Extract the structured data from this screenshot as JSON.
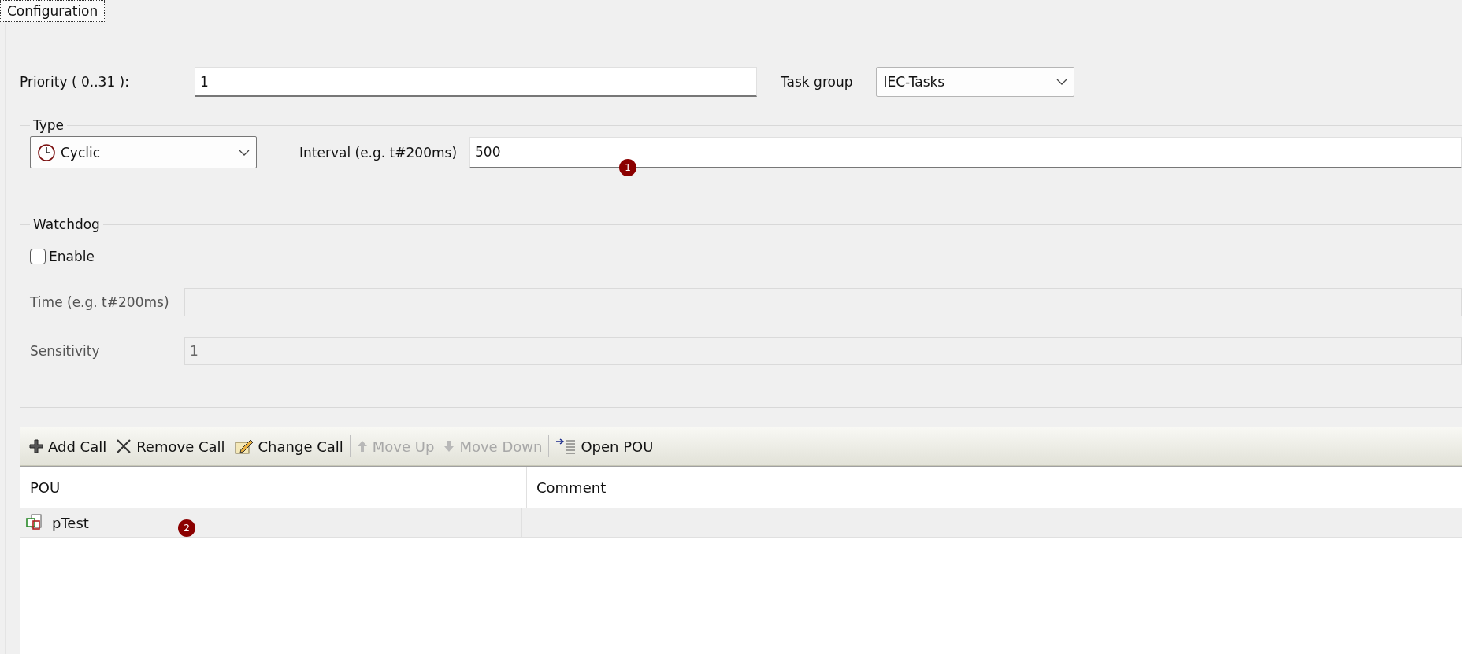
{
  "tabs": [
    {
      "label": "Configuration",
      "selected": true
    }
  ],
  "priority": {
    "label": "Priority ( 0..31  ):",
    "value": "1"
  },
  "task_group": {
    "label": "Task group",
    "value": "IEC-Tasks"
  },
  "type": {
    "legend": "Type",
    "value": "Cyclic",
    "interval_label": "Interval (e.g. t#200ms)",
    "interval_value": "500"
  },
  "watchdog": {
    "legend": "Watchdog",
    "enable": {
      "label": "Enable",
      "checked": false
    },
    "fields": [
      {
        "label": "Time (e.g. t#200ms)",
        "disabled": true
      },
      {
        "label": "Sensitivity",
        "value": "1",
        "disabled": true
      }
    ]
  },
  "toolbar": [
    {
      "kind": "add",
      "label": "Add Call",
      "disabled": false
    },
    {
      "kind": "remove",
      "label": "Remove Call",
      "disabled": false
    },
    {
      "kind": "change",
      "label": "Change Call",
      "disabled": false
    },
    {
      "kind": "up",
      "label": "Move Up",
      "disabled": true
    },
    {
      "kind": "down",
      "label": "Move Down",
      "disabled": true
    },
    {
      "kind": "open",
      "label": "Open POU",
      "disabled": false
    }
  ],
  "table": {
    "columns": [
      "POU",
      "Comment"
    ],
    "rows": [
      {
        "pou": "pTest"
      }
    ]
  },
  "markers": [
    {
      "label": "1"
    },
    {
      "label": "2"
    }
  ]
}
